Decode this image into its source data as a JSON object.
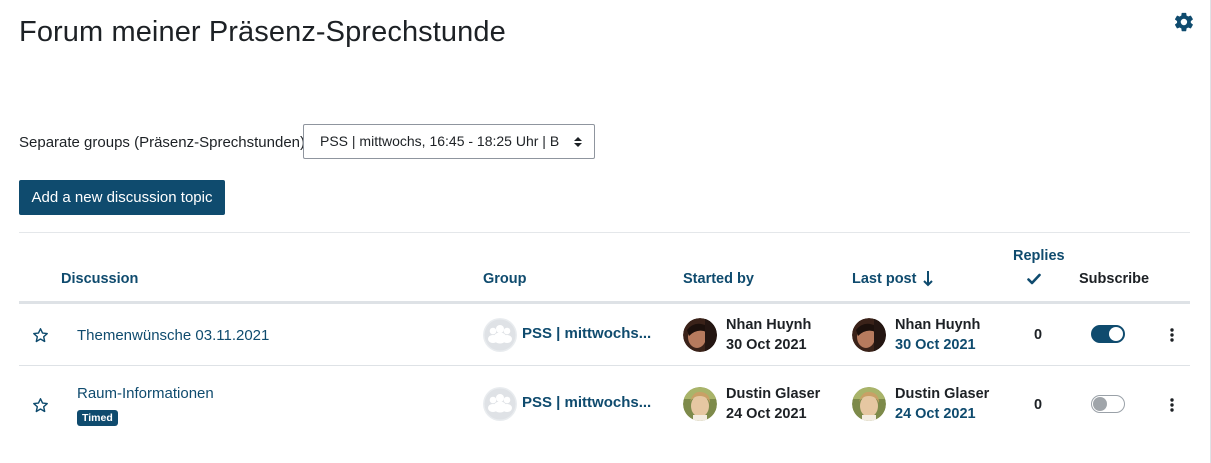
{
  "page": {
    "title": "Forum meiner Präsenz-Sprechstunde",
    "settings_icon": "gear-icon"
  },
  "groups": {
    "label": "Separate groups (Präsenz-Sprechstunden)",
    "selected": "PSS | mittwochs, 16:45 - 18:25 Uhr | B"
  },
  "actions": {
    "add_topic": "Add a new discussion topic"
  },
  "table": {
    "headers": {
      "discussion": "Discussion",
      "group": "Group",
      "started_by": "Started by",
      "last_post": "Last post",
      "replies": "Replies",
      "subscribe": "Subscribe"
    },
    "rows": [
      {
        "title": "Themenwünsche 03.11.2021",
        "badge": "",
        "group": "PSS | mittwochs...",
        "started_by": "Nhan Huynh",
        "started_date": "30 Oct 2021",
        "last_post_by": "Nhan Huynh",
        "last_post_date": "30 Oct 2021",
        "replies": "0",
        "subscribed": true
      },
      {
        "title": "Raum-Informationen",
        "badge": "Timed",
        "group": "PSS | mittwochs...",
        "started_by": "Dustin Glaser",
        "started_date": "24 Oct 2021",
        "last_post_by": "Dustin Glaser",
        "last_post_date": "24 Oct 2021",
        "replies": "0",
        "subscribed": false
      }
    ]
  },
  "colors": {
    "accent": "#0f4b6e",
    "text": "#1d2125",
    "border": "#dee2e6"
  }
}
